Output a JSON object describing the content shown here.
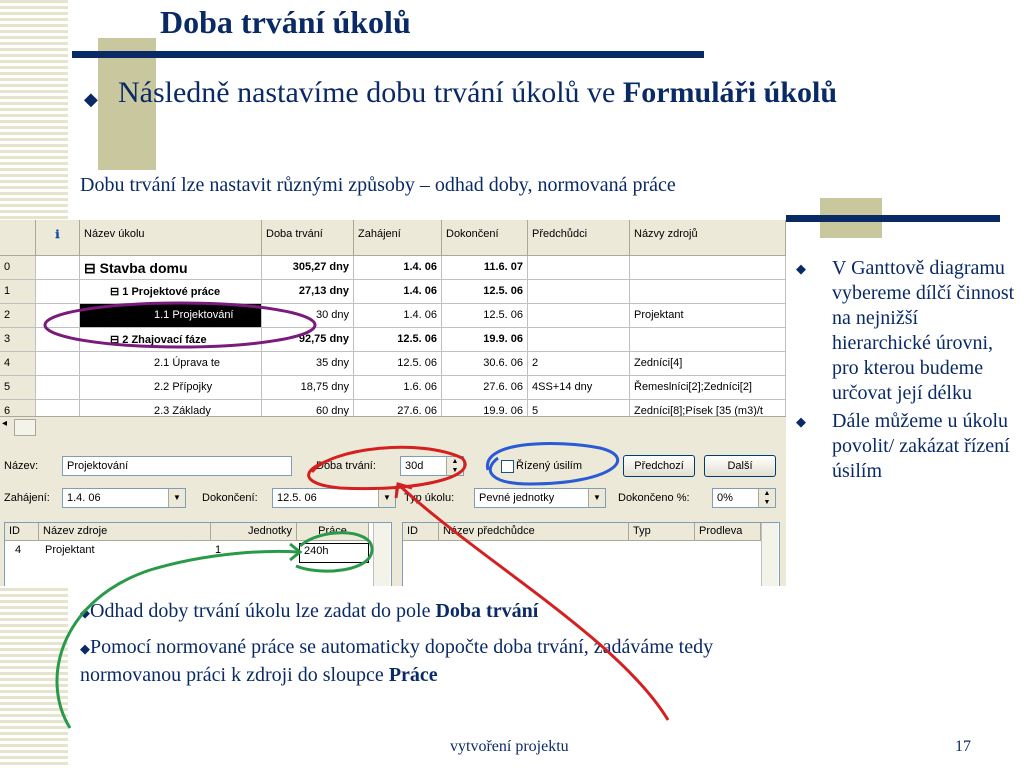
{
  "slide": {
    "title": "Doba trvání úkolů",
    "bullet_prefix": "Následně nastavíme dobu trvání úkolů ve ",
    "bullet_bold": "Formuláři úkolů",
    "subtitle": "Dobu trvání lze nastavit různými způsoby – odhad doby, normovaná práce"
  },
  "gantt": {
    "columns": [
      "",
      "ℹ",
      "Název úkolu",
      "Doba trvání",
      "Zahájení",
      "Dokončení",
      "Předchůdci",
      "Názvy zdrojů"
    ],
    "rows": [
      {
        "id": "0",
        "name": "⊟ Stavba domu",
        "duration": "305,27 dny",
        "start": "1.4. 06",
        "finish": "11.6. 07",
        "pred": "",
        "res": ""
      },
      {
        "id": "1",
        "name": "⊟ 1 Projektové práce",
        "duration": "27,13 dny",
        "start": "1.4. 06",
        "finish": "12.5. 06",
        "pred": "",
        "res": ""
      },
      {
        "id": "2",
        "name": "1.1   Projektování",
        "duration": "30 dny",
        "start": "1.4. 06",
        "finish": "12.5. 06",
        "pred": "",
        "res": "Projektant"
      },
      {
        "id": "3",
        "name": "⊟ 2 Zhajovací fáze",
        "duration": "92,75 dny",
        "start": "12.5. 06",
        "finish": "19.9. 06",
        "pred": "",
        "res": ""
      },
      {
        "id": "4",
        "name": "2.1   Úprava te",
        "duration": "35 dny",
        "start": "12.5. 06",
        "finish": "30.6. 06",
        "pred": "2",
        "res": "Zedníci[4]"
      },
      {
        "id": "5",
        "name": "2.2   Přípojky",
        "duration": "18,75 dny",
        "start": "1.6. 06",
        "finish": "27.6. 06",
        "pred": "4SS+14 dny",
        "res": "Řemeslníci[2];Zedníci[2]"
      },
      {
        "id": "6",
        "name": "2.3   Základy",
        "duration": "60 dny",
        "start": "27.6. 06",
        "finish": "19.9. 06",
        "pred": "5",
        "res": "Zedníci[8];Písek [35 (m3)/t"
      }
    ]
  },
  "form": {
    "name_label": "Název:",
    "name_value": "Projektování",
    "duration_label": "Doba trvání:",
    "duration_value": "30d",
    "effort_label": "Řízený úsilím",
    "prev_button": "Předchozí",
    "next_button": "Další",
    "start_label": "Zahájení:",
    "start_value": "1.4. 06",
    "finish_label": "Dokončení:",
    "finish_value": "12.5. 06",
    "tasktype_label": "Typ úkolu:",
    "tasktype_value": "Pevné jednotky",
    "complete_label": "Dokončeno %:",
    "complete_value": "0%",
    "res_headers": [
      "ID",
      "Název zdroje",
      "Jednotky",
      "Práce"
    ],
    "res_row": {
      "id": "4",
      "name": "Projektant",
      "units": "1",
      "work": "240h"
    },
    "pred_headers": [
      "ID",
      "Název předchůdce",
      "Typ",
      "Prodleva"
    ]
  },
  "side_bullets": [
    "V Ganttově diagramu vybereme dílčí činnost na nejnižší hierarchické úrovni, pro kterou budeme určovat její délku",
    "Dále můžeme u úkolu povolit/ zakázat řízení úsilím"
  ],
  "notes": {
    "n1_prefix": "Odhad doby trvání úkolu lze zadat do pole ",
    "n1_bold": "Doba trvání",
    "n2_prefix": "Pomocí normované práce se automaticky dopočte doba trvání, zadáváme tedy normovanou práci k zdroji do sloupce ",
    "n2_bold": "Práce"
  },
  "footer": {
    "text": "vytvoření projektu",
    "page": "17"
  },
  "colors": {
    "accent": "#0a2a66",
    "highlight_purple": "#7a1a7a",
    "highlight_red": "#d42020",
    "highlight_blue": "#2a5ad4",
    "highlight_green": "#2a9a4a"
  }
}
